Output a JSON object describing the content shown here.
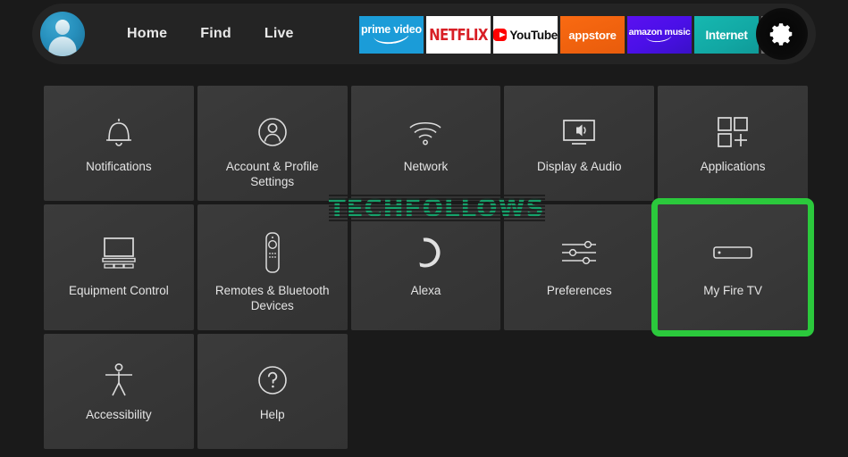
{
  "window": {
    "background_color": "#1a1a1a",
    "accent_color": "#2bc93c"
  },
  "topbar": {
    "avatar": {
      "name": "profile-avatar",
      "color": "#2790bd"
    },
    "nav_items": [
      {
        "label": "Home"
      },
      {
        "label": "Find"
      },
      {
        "label": "Live"
      }
    ],
    "app_tiles": [
      {
        "id": "prime-video",
        "line1": "prime",
        "line2": "video",
        "bg": "#1b9cd8"
      },
      {
        "id": "netflix",
        "label": "NETFLIX",
        "bg": "#ffffff",
        "fg": "#d81f26"
      },
      {
        "id": "youtube",
        "label": "YouTube",
        "bg": "#ffffff",
        "fg": "#0d0d0d"
      },
      {
        "id": "appstore",
        "label": "appstore",
        "bg": "#f0620e"
      },
      {
        "id": "amazon-music",
        "label1": "amazon",
        "label2": "music",
        "bg": "#4b10e8"
      },
      {
        "id": "internet",
        "label": "Internet",
        "bg": "#12a8a4"
      },
      {
        "id": "apps-grid",
        "label": "",
        "bg": "#6f6f6f"
      }
    ],
    "settings_button": {
      "icon": "gear-icon",
      "label": ""
    }
  },
  "grid": {
    "rows": [
      {
        "tiles": [
          {
            "id": "notifications",
            "label": "Notifications",
            "icon": "bell-icon",
            "selected": false
          },
          {
            "id": "account-profile-settings",
            "label": "Account & Profile Settings",
            "icon": "person-circle-icon",
            "selected": false
          },
          {
            "id": "network",
            "label": "Network",
            "icon": "wifi-icon",
            "selected": false
          },
          {
            "id": "display-audio",
            "label": "Display & Audio",
            "icon": "tv-speaker-icon",
            "selected": false
          },
          {
            "id": "applications",
            "label": "Applications",
            "icon": "apps-grid-plus-icon",
            "selected": false
          }
        ]
      },
      {
        "tiles": [
          {
            "id": "equipment-control",
            "label": "Equipment Control",
            "icon": "tv-soundbar-icon",
            "selected": false
          },
          {
            "id": "remotes-bluetooth-devices",
            "label": "Remotes & Bluetooth Devices",
            "icon": "remote-icon",
            "selected": false
          },
          {
            "id": "alexa",
            "label": "Alexa",
            "icon": "alexa-ring-icon",
            "selected": false
          },
          {
            "id": "preferences",
            "label": "Preferences",
            "icon": "sliders-icon",
            "selected": false
          },
          {
            "id": "my-fire-tv",
            "label": "My Fire TV",
            "icon": "fire-tv-stick-icon",
            "selected": true
          }
        ]
      },
      {
        "tiles": [
          {
            "id": "accessibility",
            "label": "Accessibility",
            "icon": "accessibility-person-icon",
            "selected": false
          },
          {
            "id": "help",
            "label": "Help",
            "icon": "question-circle-icon",
            "selected": false
          }
        ]
      }
    ]
  },
  "watermark": {
    "text": "TECHFOLLOWS",
    "color": "#16a06a"
  }
}
